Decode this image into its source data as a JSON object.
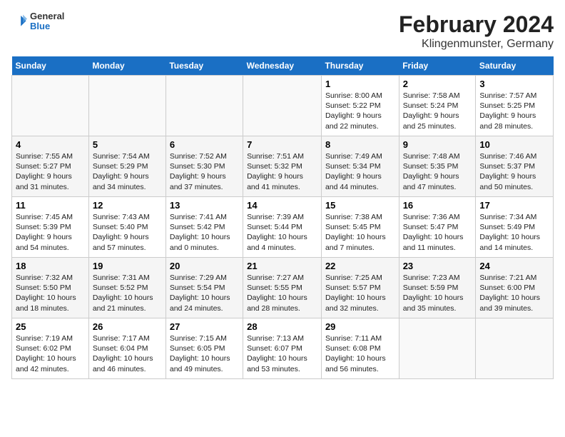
{
  "header": {
    "logo": {
      "general": "General",
      "blue": "Blue"
    },
    "title": "February 2024",
    "subtitle": "Klingenmunster, Germany"
  },
  "days_of_week": [
    "Sunday",
    "Monday",
    "Tuesday",
    "Wednesday",
    "Thursday",
    "Friday",
    "Saturday"
  ],
  "weeks": [
    [
      {
        "day": "",
        "info": ""
      },
      {
        "day": "",
        "info": ""
      },
      {
        "day": "",
        "info": ""
      },
      {
        "day": "",
        "info": ""
      },
      {
        "day": "1",
        "info": "Sunrise: 8:00 AM\nSunset: 5:22 PM\nDaylight: 9 hours\nand 22 minutes."
      },
      {
        "day": "2",
        "info": "Sunrise: 7:58 AM\nSunset: 5:24 PM\nDaylight: 9 hours\nand 25 minutes."
      },
      {
        "day": "3",
        "info": "Sunrise: 7:57 AM\nSunset: 5:25 PM\nDaylight: 9 hours\nand 28 minutes."
      }
    ],
    [
      {
        "day": "4",
        "info": "Sunrise: 7:55 AM\nSunset: 5:27 PM\nDaylight: 9 hours\nand 31 minutes."
      },
      {
        "day": "5",
        "info": "Sunrise: 7:54 AM\nSunset: 5:29 PM\nDaylight: 9 hours\nand 34 minutes."
      },
      {
        "day": "6",
        "info": "Sunrise: 7:52 AM\nSunset: 5:30 PM\nDaylight: 9 hours\nand 37 minutes."
      },
      {
        "day": "7",
        "info": "Sunrise: 7:51 AM\nSunset: 5:32 PM\nDaylight: 9 hours\nand 41 minutes."
      },
      {
        "day": "8",
        "info": "Sunrise: 7:49 AM\nSunset: 5:34 PM\nDaylight: 9 hours\nand 44 minutes."
      },
      {
        "day": "9",
        "info": "Sunrise: 7:48 AM\nSunset: 5:35 PM\nDaylight: 9 hours\nand 47 minutes."
      },
      {
        "day": "10",
        "info": "Sunrise: 7:46 AM\nSunset: 5:37 PM\nDaylight: 9 hours\nand 50 minutes."
      }
    ],
    [
      {
        "day": "11",
        "info": "Sunrise: 7:45 AM\nSunset: 5:39 PM\nDaylight: 9 hours\nand 54 minutes."
      },
      {
        "day": "12",
        "info": "Sunrise: 7:43 AM\nSunset: 5:40 PM\nDaylight: 9 hours\nand 57 minutes."
      },
      {
        "day": "13",
        "info": "Sunrise: 7:41 AM\nSunset: 5:42 PM\nDaylight: 10 hours\nand 0 minutes."
      },
      {
        "day": "14",
        "info": "Sunrise: 7:39 AM\nSunset: 5:44 PM\nDaylight: 10 hours\nand 4 minutes."
      },
      {
        "day": "15",
        "info": "Sunrise: 7:38 AM\nSunset: 5:45 PM\nDaylight: 10 hours\nand 7 minutes."
      },
      {
        "day": "16",
        "info": "Sunrise: 7:36 AM\nSunset: 5:47 PM\nDaylight: 10 hours\nand 11 minutes."
      },
      {
        "day": "17",
        "info": "Sunrise: 7:34 AM\nSunset: 5:49 PM\nDaylight: 10 hours\nand 14 minutes."
      }
    ],
    [
      {
        "day": "18",
        "info": "Sunrise: 7:32 AM\nSunset: 5:50 PM\nDaylight: 10 hours\nand 18 minutes."
      },
      {
        "day": "19",
        "info": "Sunrise: 7:31 AM\nSunset: 5:52 PM\nDaylight: 10 hours\nand 21 minutes."
      },
      {
        "day": "20",
        "info": "Sunrise: 7:29 AM\nSunset: 5:54 PM\nDaylight: 10 hours\nand 24 minutes."
      },
      {
        "day": "21",
        "info": "Sunrise: 7:27 AM\nSunset: 5:55 PM\nDaylight: 10 hours\nand 28 minutes."
      },
      {
        "day": "22",
        "info": "Sunrise: 7:25 AM\nSunset: 5:57 PM\nDaylight: 10 hours\nand 32 minutes."
      },
      {
        "day": "23",
        "info": "Sunrise: 7:23 AM\nSunset: 5:59 PM\nDaylight: 10 hours\nand 35 minutes."
      },
      {
        "day": "24",
        "info": "Sunrise: 7:21 AM\nSunset: 6:00 PM\nDaylight: 10 hours\nand 39 minutes."
      }
    ],
    [
      {
        "day": "25",
        "info": "Sunrise: 7:19 AM\nSunset: 6:02 PM\nDaylight: 10 hours\nand 42 minutes."
      },
      {
        "day": "26",
        "info": "Sunrise: 7:17 AM\nSunset: 6:04 PM\nDaylight: 10 hours\nand 46 minutes."
      },
      {
        "day": "27",
        "info": "Sunrise: 7:15 AM\nSunset: 6:05 PM\nDaylight: 10 hours\nand 49 minutes."
      },
      {
        "day": "28",
        "info": "Sunrise: 7:13 AM\nSunset: 6:07 PM\nDaylight: 10 hours\nand 53 minutes."
      },
      {
        "day": "29",
        "info": "Sunrise: 7:11 AM\nSunset: 6:08 PM\nDaylight: 10 hours\nand 56 minutes."
      },
      {
        "day": "",
        "info": ""
      },
      {
        "day": "",
        "info": ""
      }
    ]
  ]
}
